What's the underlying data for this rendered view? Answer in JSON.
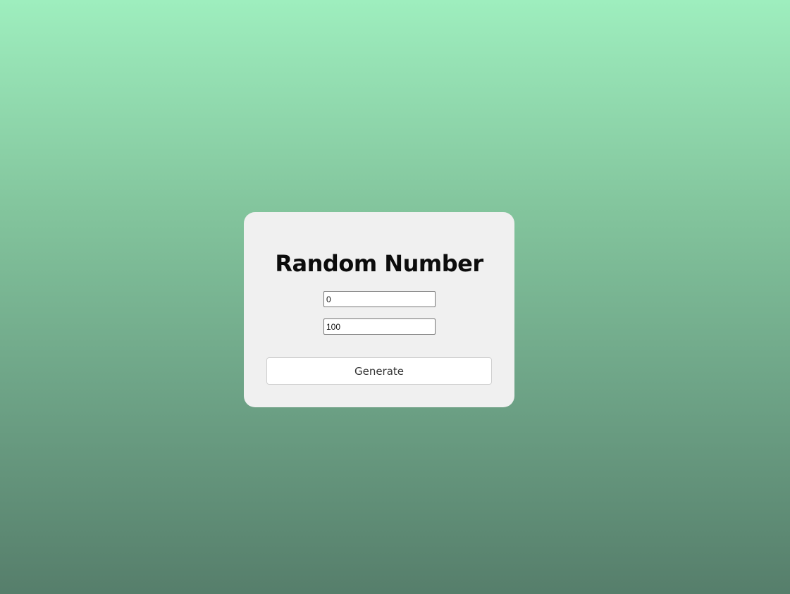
{
  "card": {
    "title": "Random Number",
    "min_input": {
      "value": "0"
    },
    "max_input": {
      "value": "100"
    },
    "generate_label": "Generate"
  },
  "colors": {
    "background_top": "#9eeebe",
    "background_bottom": "#567e6b",
    "card_background": "#f0f0f0",
    "button_background": "#ffffff"
  }
}
